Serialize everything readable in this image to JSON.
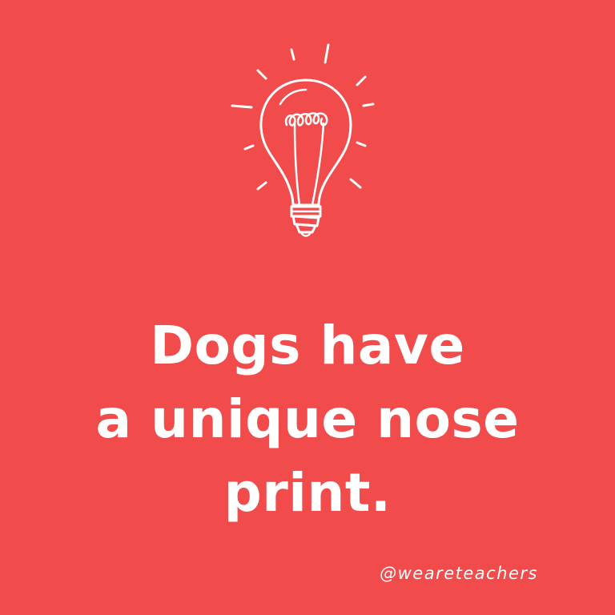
{
  "colors": {
    "background": "#f24b4b",
    "foreground": "#ffffff"
  },
  "illustration": {
    "icon": "lightbulb-icon"
  },
  "fact": {
    "lines": [
      "Dogs have",
      "a unique nose",
      "print."
    ]
  },
  "credit": {
    "handle": "@weareteachers"
  }
}
